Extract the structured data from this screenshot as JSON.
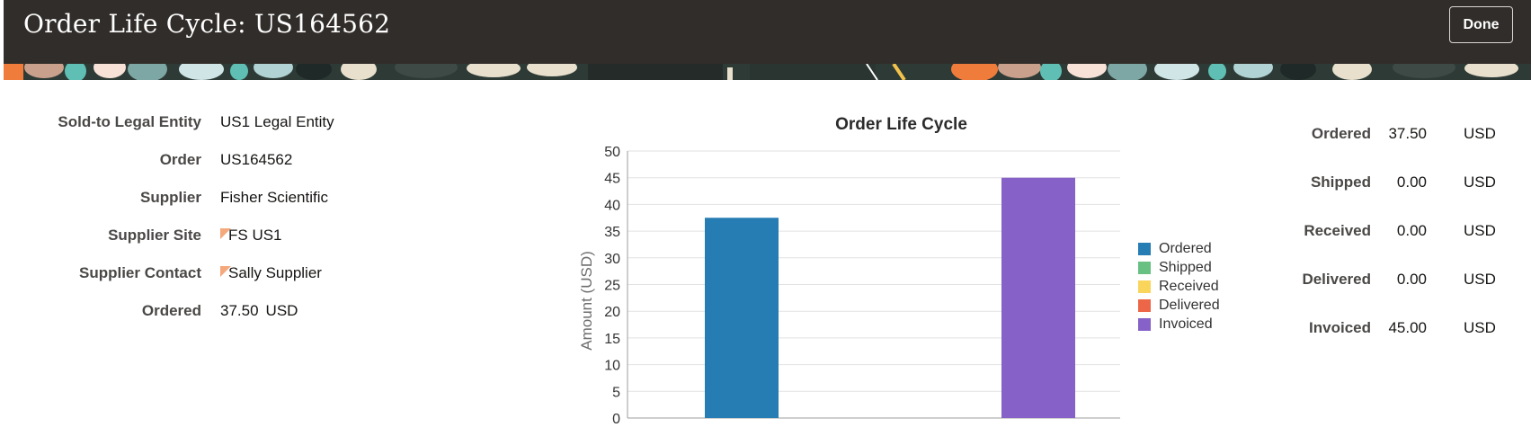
{
  "header": {
    "title": "Order Life Cycle: US164562",
    "done_label": "Done"
  },
  "details": [
    {
      "label": "Sold-to Legal Entity",
      "value": "US1 Legal Entity"
    },
    {
      "label": "Order",
      "value": "US164562"
    },
    {
      "label": "Supplier",
      "value": "Fisher Scientific"
    },
    {
      "label": "Supplier Site",
      "value": "FS US1"
    },
    {
      "label": "Supplier Contact",
      "value": "Sally Supplier"
    },
    {
      "label": "Ordered",
      "value": "37.50",
      "currency": "USD"
    }
  ],
  "summary": [
    {
      "label": "Ordered",
      "amount": "37.50",
      "currency": "USD"
    },
    {
      "label": "Shipped",
      "amount": "0.00",
      "currency": "USD"
    },
    {
      "label": "Received",
      "amount": "0.00",
      "currency": "USD"
    },
    {
      "label": "Delivered",
      "amount": "0.00",
      "currency": "USD"
    },
    {
      "label": "Invoiced",
      "amount": "45.00",
      "currency": "USD"
    }
  ],
  "chart_data": {
    "type": "bar",
    "title": "Order Life Cycle",
    "xlabel": "",
    "ylabel": "Amount (USD)",
    "ylim": [
      0,
      50
    ],
    "yticks": [
      0,
      5,
      10,
      15,
      20,
      25,
      30,
      35,
      40,
      45,
      50
    ],
    "grid": true,
    "legend_position": "right",
    "series": [
      {
        "name": "Ordered",
        "value": 37.5,
        "color": "#267db3"
      },
      {
        "name": "Shipped",
        "value": 0,
        "color": "#68c182"
      },
      {
        "name": "Received",
        "value": 0,
        "color": "#fad55c"
      },
      {
        "name": "Delivered",
        "value": 0,
        "color": "#ed6647"
      },
      {
        "name": "Invoiced",
        "value": 45,
        "color": "#8561c8"
      }
    ]
  }
}
